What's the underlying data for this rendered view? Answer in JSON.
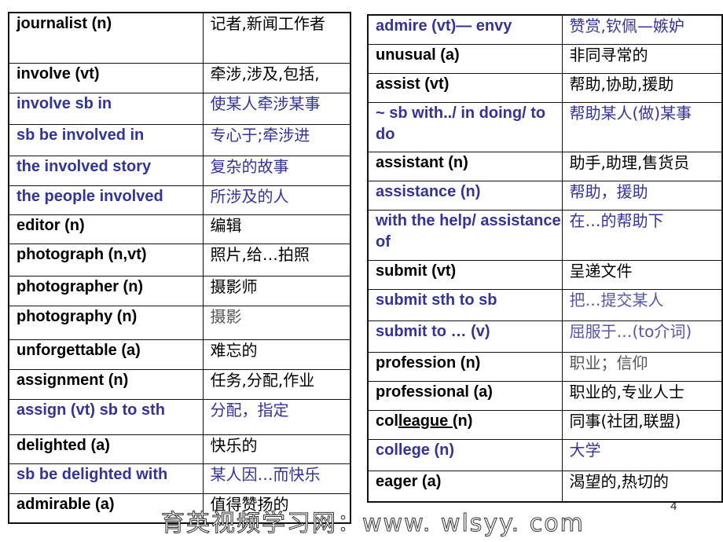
{
  "colors": {
    "blue": "#333399",
    "black": "#000000",
    "border": "#111111"
  },
  "left_table": {
    "rows": [
      {
        "en": "journalist (n)",
        "zh": "记者,新闻工作者",
        "style": "black",
        "h": 64
      },
      {
        "en": "involve (vt)",
        "zh": "牵涉,涉及,包括,",
        "style": "black",
        "h": 38
      },
      {
        "en": "involve sb in",
        "zh": "使某人牵涉某事",
        "style": "blue",
        "h": 40
      },
      {
        "en": "sb be involved in",
        "zh": "专心于;牵涉进",
        "style": "blue",
        "h": 40
      },
      {
        "en": "the involved story",
        "zh": "复杂的故事",
        "style": "blue",
        "h": 38
      },
      {
        "en": "the people involved",
        "zh": "所涉及的人",
        "style": "blue",
        "h": 37
      },
      {
        "en": "editor (n)",
        "zh": "编辑",
        "style": "black",
        "h": 37
      },
      {
        "en": "photograph (n,vt)",
        "zh": "照片,给…拍照",
        "style": "black",
        "h": 41
      },
      {
        "en": "photographer (n)",
        "zh": "摄影师",
        "style": "black",
        "h": 38
      },
      {
        "en": "photography (n)",
        "zh": "摄影",
        "style": "black-gray",
        "h": 43
      },
      {
        "en": "unforgettable (a)",
        "zh": "难忘的",
        "style": "black",
        "h": 38
      },
      {
        "en": "assignment (n)",
        "zh": "任务,分配,作业",
        "style": "black",
        "h": 38
      },
      {
        "en": "assign (vt) sb to sth",
        "zh": "分配，指定",
        "style": "blue",
        "h": 45
      },
      {
        "en": "delighted (a)",
        "zh": "快乐的",
        "style": "black",
        "h": 37
      },
      {
        "en": "sb be delighted with",
        "zh": "某人因…而快乐",
        "style": "blue",
        "h": 38
      },
      {
        "en": "admirable (a)",
        "zh": "值得赞扬的",
        "style": "black",
        "h": 38
      }
    ]
  },
  "right_table": {
    "rows": [
      {
        "en": "admire (vt)— envy",
        "zh": "赞赏,钦佩—嫉妒",
        "style": "blue",
        "h": 37
      },
      {
        "en": "unusual (a)",
        "zh": "非同寻常的",
        "style": "black",
        "h": 37
      },
      {
        "en": "assist (vt)",
        "zh": "帮助,协助,援助",
        "style": "black",
        "h": 37
      },
      {
        "en": "~ sb with../ in doing/ to do",
        "zh": "帮助某人(做)某事",
        "style": "blue",
        "h": 63
      },
      {
        "en": "assistant  (n)",
        "zh": "助手,助理,售货员",
        "style": "black",
        "h": 37
      },
      {
        "en": "assistance  (n)",
        "zh": "帮助，援助",
        "style": "blue",
        "h": 37
      },
      {
        "en": "with the help/ assistance of",
        "zh": "在…的帮助下",
        "style": "blue",
        "h": 64
      },
      {
        "en": "submit (vt)",
        "zh": "呈递文件",
        "style": "black",
        "h": 37
      },
      {
        "en": "submit sth to sb",
        "zh": "把…提交某人",
        "style": "blue-light",
        "h": 40
      },
      {
        "en": "submit to … (v)",
        "zh": "屈服于…(to介词)",
        "style": "blue-light",
        "h": 40
      },
      {
        "en": "profession (n)",
        "zh": "职业；信仰",
        "style": "black-gray",
        "h": 37
      },
      {
        "en": "professional (a)",
        "zh": "职业的,专业人士",
        "style": "black",
        "h": 37
      },
      {
        "en": "colleague (n)",
        "en_parts": [
          "col",
          "league ",
          "(n)"
        ],
        "zh": "同事(社团,联盟)",
        "style": "black",
        "h": 37
      },
      {
        "en": "college (n)",
        "zh": "大学",
        "style": "blue",
        "h": 40
      },
      {
        "en": "eager (a)",
        "zh": "渴望的,热切的",
        "style": "black",
        "h": 40
      }
    ]
  },
  "page_number": "4",
  "watermark": "育英视频学习网：www. wlsyy. com"
}
